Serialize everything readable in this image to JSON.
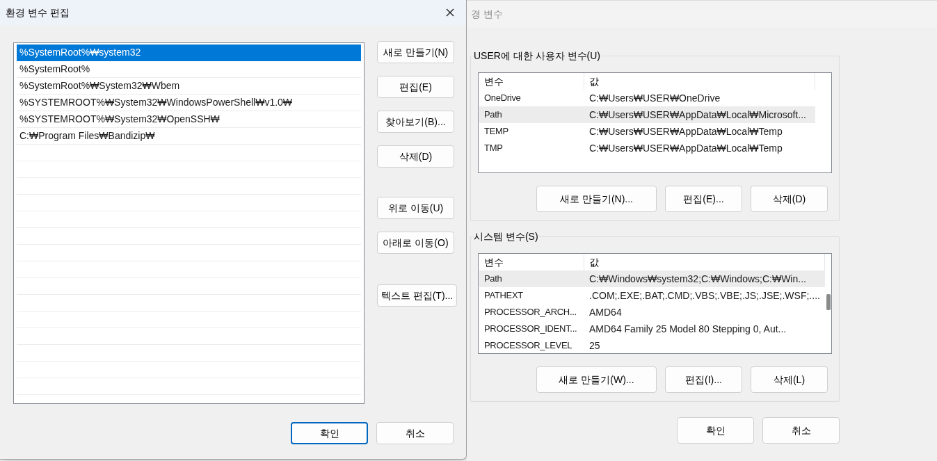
{
  "edit_dialog": {
    "title": "환경 변수 편집",
    "paths": [
      {
        "text": "%SystemRoot%₩system32",
        "selected": true
      },
      {
        "text": "%SystemRoot%",
        "selected": false
      },
      {
        "text": "%SystemRoot%₩System32₩Wbem",
        "selected": false
      },
      {
        "text": "%SYSTEMROOT%₩System32₩WindowsPowerShell₩v1.0₩",
        "selected": false
      },
      {
        "text": "%SYSTEMROOT%₩System32₩OpenSSH₩",
        "selected": false
      },
      {
        "text": "C:₩Program Files₩Bandizip₩",
        "selected": false
      }
    ],
    "side_buttons": [
      "새로 만들기(N)",
      "편집(E)",
      "찾아보기(B)...",
      "삭제(D)",
      "위로 이동(U)",
      "아래로 이동(O)",
      "텍스트 편집(T)..."
    ],
    "ok_button": "확인",
    "cancel_button": "취소"
  },
  "env_window": {
    "title": "경 변수",
    "user_group": {
      "legend": "USER에 대한 사용자 변수(U)",
      "columns": [
        "변수",
        "값"
      ],
      "rows": [
        {
          "cells": [
            "OneDrive",
            "C:₩Users₩USER₩OneDrive"
          ],
          "selected": false
        },
        {
          "cells": [
            "Path",
            "C:₩Users₩USER₩AppData₩Local₩Microsoft..."
          ],
          "selected": true
        },
        {
          "cells": [
            "TEMP",
            "C:₩Users₩USER₩AppData₩Local₩Temp"
          ],
          "selected": false
        },
        {
          "cells": [
            "TMP",
            "C:₩Users₩USER₩AppData₩Local₩Temp"
          ],
          "selected": false
        }
      ],
      "buttons": [
        "새로 만들기(N)...",
        "편집(E)...",
        "삭제(D)"
      ]
    },
    "system_group": {
      "legend": "시스템 변수(S)",
      "columns": [
        "변수",
        "값"
      ],
      "rows": [
        {
          "cells": [
            "Path",
            "C:₩Windows₩system32;C:₩Windows;C:₩Win..."
          ],
          "selected": true
        },
        {
          "cells": [
            "PATHEXT",
            ".COM;.EXE;.BAT;.CMD;.VBS;.VBE;.JS;.JSE;.WSF;...."
          ],
          "selected": false
        },
        {
          "cells": [
            "PROCESSOR_ARCH...",
            "AMD64"
          ],
          "selected": false
        },
        {
          "cells": [
            "PROCESSOR_IDENT...",
            "AMD64 Family 25 Model 80 Stepping 0, Aut..."
          ],
          "selected": false
        },
        {
          "cells": [
            "PROCESSOR_LEVEL",
            "25"
          ],
          "selected": false
        }
      ],
      "buttons": [
        "새로 만들기(W)...",
        "편집(I)...",
        "삭제(L)"
      ]
    },
    "ok_button": "확인",
    "cancel_button": "취소"
  }
}
